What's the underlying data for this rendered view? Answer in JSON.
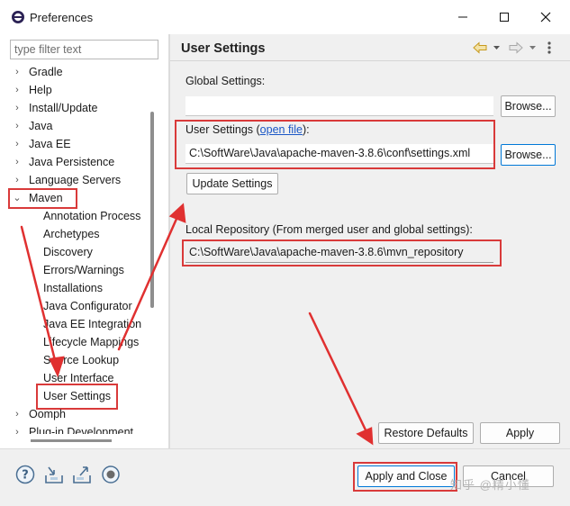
{
  "window": {
    "title": "Preferences"
  },
  "filter": {
    "placeholder": "type filter text"
  },
  "tree": {
    "top_items": [
      {
        "label": "Gradle"
      },
      {
        "label": "Help"
      },
      {
        "label": "Install/Update"
      },
      {
        "label": "Java"
      },
      {
        "label": "Java EE"
      },
      {
        "label": "Java Persistence"
      },
      {
        "label": "Language Servers"
      }
    ],
    "maven": {
      "label": "Maven"
    },
    "maven_children": [
      {
        "label": "Annotation Process"
      },
      {
        "label": "Archetypes"
      },
      {
        "label": "Discovery"
      },
      {
        "label": "Errors/Warnings"
      },
      {
        "label": "Installations"
      },
      {
        "label": "Java Configurator"
      },
      {
        "label": "Java EE Integration"
      },
      {
        "label": "Lifecycle Mappings"
      },
      {
        "label": "Source Lookup"
      },
      {
        "label": "User Interface"
      },
      {
        "label": "User Settings"
      }
    ],
    "after_items": [
      {
        "label": "Oomph"
      },
      {
        "label": "Plug-in Development"
      }
    ]
  },
  "page": {
    "title": "User Settings",
    "global_settings_label": "Global Settings:",
    "global_settings_value": "",
    "user_settings_label": "User Settings (",
    "user_settings_link": "open file",
    "user_settings_label_end": "):",
    "user_settings_value": "C:\\SoftWare\\Java\\apache-maven-3.8.6\\conf\\settings.xml",
    "browse_label": "Browse...",
    "update_settings_label": "Update Settings",
    "local_repo_label": "Local Repository (From merged user and global settings):",
    "local_repo_value": "C:\\SoftWare\\Java\\apache-maven-3.8.6\\mvn_repository",
    "restore_defaults_label": "Restore Defaults",
    "apply_label": "Apply"
  },
  "bottom": {
    "apply_close_label": "Apply and Close",
    "cancel_label": "Cancel"
  },
  "watermark": "知乎 @精小懂",
  "colors": {
    "annotation_red": "#d93a3a",
    "link_blue": "#1a57c6",
    "focus_blue": "#0078d7"
  }
}
